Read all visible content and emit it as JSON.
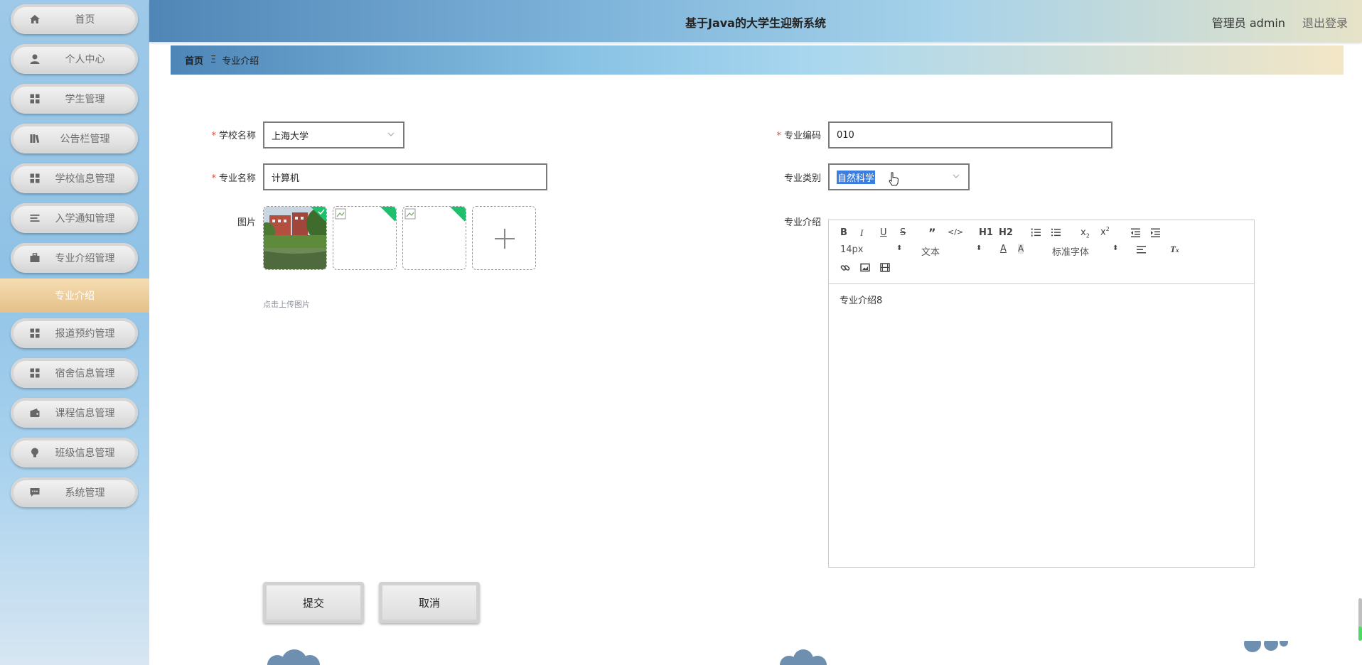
{
  "app": {
    "title": "基于Java的大学生迎新系统",
    "user": "管理员 admin",
    "logout": "退出登录"
  },
  "sidebar": {
    "items": [
      {
        "label": "首页",
        "icon": "home-icon"
      },
      {
        "label": "个人中心",
        "icon": "user-icon"
      },
      {
        "label": "学生管理",
        "icon": "grid-icon"
      },
      {
        "label": "公告栏管理",
        "icon": "books-icon"
      },
      {
        "label": "学校信息管理",
        "icon": "grid-icon"
      },
      {
        "label": "入学通知管理",
        "icon": "list-icon"
      },
      {
        "label": "专业介绍管理",
        "icon": "briefcase-icon"
      },
      {
        "label": "报道预约管理",
        "icon": "grid-icon"
      },
      {
        "label": "宿舍信息管理",
        "icon": "grid-icon"
      },
      {
        "label": "课程信息管理",
        "icon": "wallet-icon"
      },
      {
        "label": "班级信息管理",
        "icon": "bulb-icon"
      },
      {
        "label": "系统管理",
        "icon": "chat-icon"
      }
    ],
    "active_sub": "专业介绍"
  },
  "breadcrumb": {
    "home": "首页",
    "separator": "Ξ",
    "current": "专业介绍"
  },
  "form": {
    "school_label": "学校名称",
    "school_value": "上海大学",
    "major_code_label": "专业编码",
    "major_code_value": "010",
    "major_name_label": "专业名称",
    "major_name_value": "计算机",
    "major_type_label": "专业类别",
    "major_type_value": "自然科学",
    "image_label": "图片",
    "upload_tip": "点击上传图片",
    "intro_label": "专业介绍",
    "intro_content": "专业介绍8",
    "submit": "提交",
    "cancel": "取消"
  },
  "editor": {
    "font_size": "14px",
    "block_type": "文本",
    "font_family": "标准字体",
    "h1": "H1",
    "h2": "H2"
  },
  "colors": {
    "accent_green": "#1fbf6d",
    "required": "#e74c3c",
    "selection": "#3b7ee0"
  }
}
